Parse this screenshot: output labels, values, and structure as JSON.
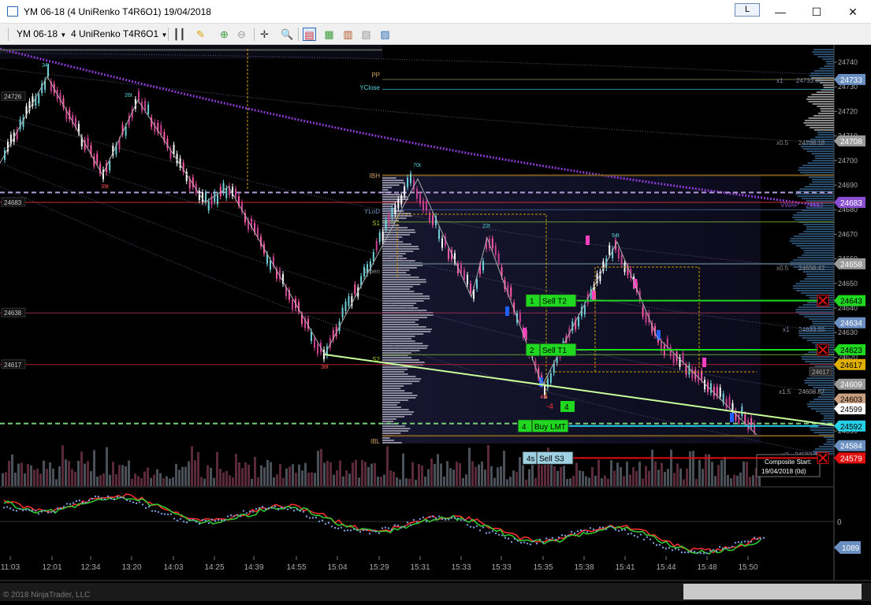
{
  "window": {
    "title": "YM 06-18 (4 UniRenko T4R6O1)  19/04/2018",
    "link_button": "L",
    "minimize": "—",
    "maximize": "☐",
    "close": "✕"
  },
  "toolbar": {
    "instrument": "YM 06-18",
    "interval": "4 UniRenko T4R6O1"
  },
  "price_axis": {
    "ticks": [
      "24740",
      "24730",
      "24720",
      "24710",
      "24700",
      "24690",
      "24680",
      "24670",
      "24660",
      "24650",
      "24640",
      "24630",
      "24620",
      "24610",
      "24600",
      "24590"
    ],
    "markers": [
      {
        "value": "24733",
        "color": "#6a8fc0"
      },
      {
        "value": "24708",
        "color": "#9a9a9a"
      },
      {
        "value": "24683",
        "color": "#8a4fd0"
      },
      {
        "value": "24658",
        "color": "#9a9a9a"
      },
      {
        "value": "24643",
        "color": "#1fd81f"
      },
      {
        "value": "24634",
        "color": "#6a8fc0"
      },
      {
        "value": "24623",
        "color": "#1fd81f"
      },
      {
        "value": "24617",
        "color": "#e0b000"
      },
      {
        "value": "24609",
        "color": "#9a9a9a"
      },
      {
        "value": "24603",
        "color": "#c8a080"
      },
      {
        "value": "24599",
        "color": "#ffffff"
      },
      {
        "value": "24592",
        "color": "#25d0e8"
      },
      {
        "value": "24584",
        "color": "#6a8fc0"
      },
      {
        "value": "24579",
        "color": "#e01010"
      }
    ],
    "left_labels": [
      "24726",
      "24683",
      "24638",
      "24617"
    ]
  },
  "levels": {
    "pp": "PP",
    "yclose": "YClose",
    "ibh": "IBH",
    "ylod": "YLoD",
    "s1": "S1",
    "open": "Open",
    "s2": "S2",
    "ibl": "IBL",
    "vwap": "VWAP",
    "x1_label": "x1",
    "x1_value": "24733.00",
    "x05_label": "x0.5",
    "x05_value": "24708.18",
    "vwap_value": "24683",
    "x05b_label": "x0.5",
    "x05b_value": "24658.42",
    "x1b_label": "x1",
    "x1b_value": "24633.55",
    "x15_label": "x1.5",
    "x15_value": "24608.67",
    "x2_label": "x2",
    "x2_value": "24583.79",
    "marker_24617": "24617"
  },
  "orders": [
    {
      "qty": "1",
      "label": "Sell T2",
      "color": "#1fd81f"
    },
    {
      "qty": "2",
      "label": "Sell T1",
      "color": "#1fd81f"
    },
    {
      "qty": "4",
      "label": "Buy LMT",
      "color": "#1fd81f"
    },
    {
      "qty": "4s",
      "label": "Sell S3",
      "color": "#9dd0e0"
    }
  ],
  "position": {
    "pnl": "-4",
    "qty": "4"
  },
  "swing_labels": [
    "34t",
    "26t",
    "70t",
    "22t",
    "54t",
    "39t",
    "38t",
    "43t"
  ],
  "composite": {
    "line1": "Composite Start:",
    "line2": "19/04/2018 (0d)"
  },
  "time_axis": [
    "11:03",
    "12:01",
    "12:34",
    "13:20",
    "14:03",
    "14:25",
    "14:39",
    "14:55",
    "15:04",
    "15:29",
    "15:31",
    "15:33",
    "15:33",
    "15:35",
    "15:38",
    "15:41",
    "15:44",
    "15:48",
    "15:50"
  ],
  "indicator": {
    "zero": "0",
    "value": "1089"
  },
  "copyright": "© 2018 NinjaTrader, LLC"
}
